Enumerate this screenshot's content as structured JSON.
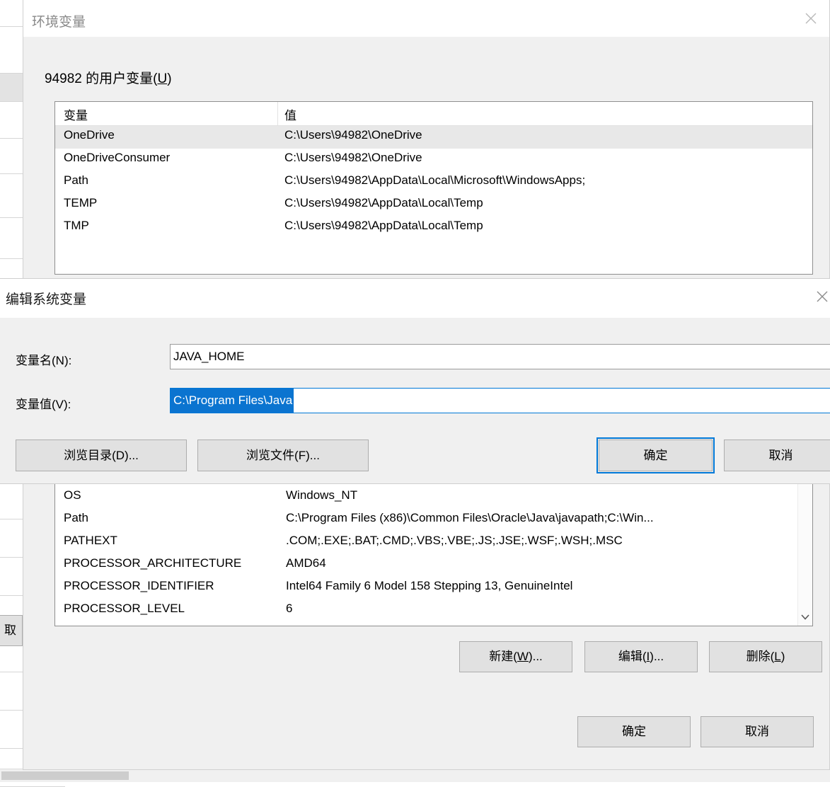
{
  "background_window": {
    "rows": [
      "plain",
      "plain",
      "sel",
      "plain",
      "plain",
      "plain",
      "plain",
      "plain",
      "blue",
      "cream",
      "plain",
      "blue"
    ]
  },
  "env_dialog": {
    "title": "环境变量",
    "close_icon": "close-icon",
    "user_section": {
      "label_prefix": "94982 的用户变量(",
      "label_accel": "U",
      "label_suffix": ")",
      "columns": [
        "变量",
        "值"
      ],
      "rows": [
        {
          "name": "OneDrive",
          "value": "C:\\Users\\94982\\OneDrive",
          "selected": true
        },
        {
          "name": "OneDriveConsumer",
          "value": "C:\\Users\\94982\\OneDrive",
          "selected": false
        },
        {
          "name": "Path",
          "value": "C:\\Users\\94982\\AppData\\Local\\Microsoft\\WindowsApps;",
          "selected": false
        },
        {
          "name": "TEMP",
          "value": "C:\\Users\\94982\\AppData\\Local\\Temp",
          "selected": false
        },
        {
          "name": "TMP",
          "value": "C:\\Users\\94982\\AppData\\Local\\Temp",
          "selected": false
        }
      ]
    },
    "system_section": {
      "rows": [
        {
          "name": "OS",
          "value": "Windows_NT"
        },
        {
          "name": "Path",
          "value": "C:\\Program Files (x86)\\Common Files\\Oracle\\Java\\javapath;C:\\Win..."
        },
        {
          "name": "PATHEXT",
          "value": ".COM;.EXE;.BAT;.CMD;.VBS;.VBE;.JS;.JSE;.WSF;.WSH;.MSC"
        },
        {
          "name": "PROCESSOR_ARCHITECTURE",
          "value": "AMD64"
        },
        {
          "name": "PROCESSOR_IDENTIFIER",
          "value": "Intel64 Family 6 Model 158 Stepping 13, GenuineIntel"
        },
        {
          "name": "PROCESSOR_LEVEL",
          "value": "6"
        }
      ],
      "buttons": {
        "new_prefix": "新建(",
        "new_accel": "W",
        "new_suffix": ")...",
        "edit_prefix": "编辑(",
        "edit_accel": "I",
        "edit_suffix": ")...",
        "delete_prefix": "删除(",
        "delete_accel": "L",
        "delete_suffix": ")"
      },
      "scrollbar": {
        "down_arrow_icon": "chevron-down-icon"
      }
    },
    "footer": {
      "ok": "确定",
      "cancel": "取消"
    },
    "peek_cancel": "取"
  },
  "edit_dialog": {
    "title": "编辑系统变量",
    "close_icon": "close-icon",
    "name_label": "变量名(N):",
    "name_value": "JAVA_HOME",
    "value_label": "变量值(V):",
    "value_selected_text": "C:\\Program Files\\Java",
    "buttons": {
      "browse_dir": "浏览目录(D)...",
      "browse_file": "浏览文件(F)...",
      "ok": "确定",
      "cancel": "取消"
    }
  },
  "colors": {
    "dialog_bg": "#f0f0f0",
    "selection_blue": "#0b74d0",
    "focus_blue": "#0078d7",
    "button_face": "#e1e1e1",
    "button_border": "#adadad",
    "row_selected": "#e8e8e8"
  }
}
